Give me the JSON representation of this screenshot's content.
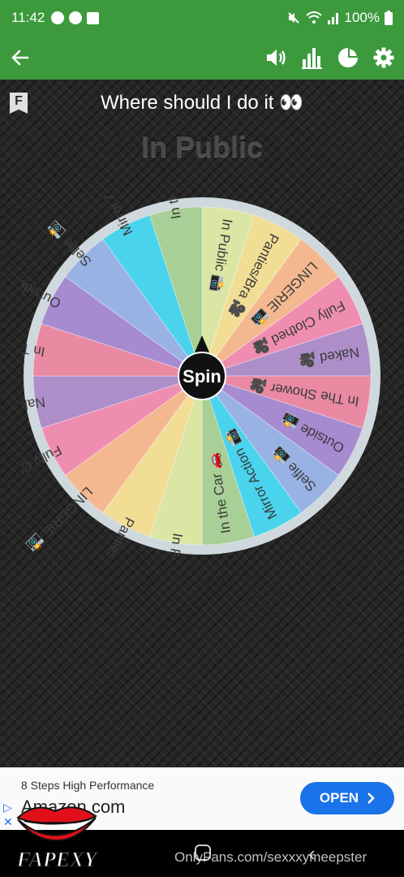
{
  "status": {
    "time": "11:42",
    "battery": "100%",
    "notification_icons": [
      "messenger-icon",
      "facebook-icon",
      "gallery-icon"
    ],
    "system_icons": [
      "mute-icon",
      "wifi-icon",
      "signal-icon",
      "battery-icon"
    ]
  },
  "toolbar": {
    "back_icon": "arrow-left-icon",
    "actions": [
      "volume-icon",
      "bar-chart-icon",
      "pie-chart-icon",
      "gear-icon"
    ]
  },
  "wheel": {
    "title": "Where should I do it 👀",
    "result": "In Public",
    "bookmark_label": "F",
    "spin_label": "Spin",
    "segments": [
      {
        "label": "In Public",
        "emoji": "📸",
        "color": "#dbe6a5"
      },
      {
        "label": "Panties/Bra",
        "emoji": "🎥",
        "color": "#f2dd95"
      },
      {
        "label": "LINGERIE",
        "emoji": "📸",
        "color": "#f4b890"
      },
      {
        "label": "Fully Clothed",
        "emoji": "🎥",
        "color": "#ef8db0"
      },
      {
        "label": "Naked",
        "emoji": "🎥",
        "color": "#ad8ec9"
      },
      {
        "label": "In The Shower",
        "emoji": "🎥",
        "color": "#e98aa2"
      },
      {
        "label": "Outside",
        "emoji": "📸",
        "color": "#a78bd1"
      },
      {
        "label": "Selfie",
        "emoji": "📸",
        "color": "#98b2e4"
      },
      {
        "label": "Mirror Action",
        "emoji": "📸",
        "color": "#49d3ed"
      },
      {
        "label": "In the Car",
        "emoji": "🚗",
        "color": "#a8cf95"
      },
      {
        "label": "In Public",
        "emoji": "📸",
        "color": "#dbe6a5"
      },
      {
        "label": "Panties/Bra",
        "emoji": "🎥",
        "color": "#f2dd95"
      },
      {
        "label": "LINGERIE",
        "emoji": "📸",
        "color": "#f4b890"
      },
      {
        "label": "Fully Clothed",
        "emoji": "🎥",
        "color": "#ef8db0"
      },
      {
        "label": "Naked",
        "emoji": "🎥",
        "color": "#ad8ec9"
      },
      {
        "label": "In The Shower",
        "emoji": "🎥",
        "color": "#e98aa2"
      },
      {
        "label": "Outside",
        "emoji": "📸",
        "color": "#a78bd1"
      },
      {
        "label": "Selfie",
        "emoji": "📸",
        "color": "#98b2e4"
      },
      {
        "label": "Mirror Action",
        "emoji": "📸",
        "color": "#49d3ed"
      },
      {
        "label": "In the Car",
        "emoji": "🚗",
        "color": "#a8cf95"
      }
    ]
  },
  "ad": {
    "subtitle": "8 Steps High Performance",
    "title": "Amazon.com",
    "button_label": "OPEN",
    "choices_label": "▷\n✕"
  },
  "watermark": "OnlyFans.com/sexxxymeepster",
  "logo_text": "FAPEXY"
}
